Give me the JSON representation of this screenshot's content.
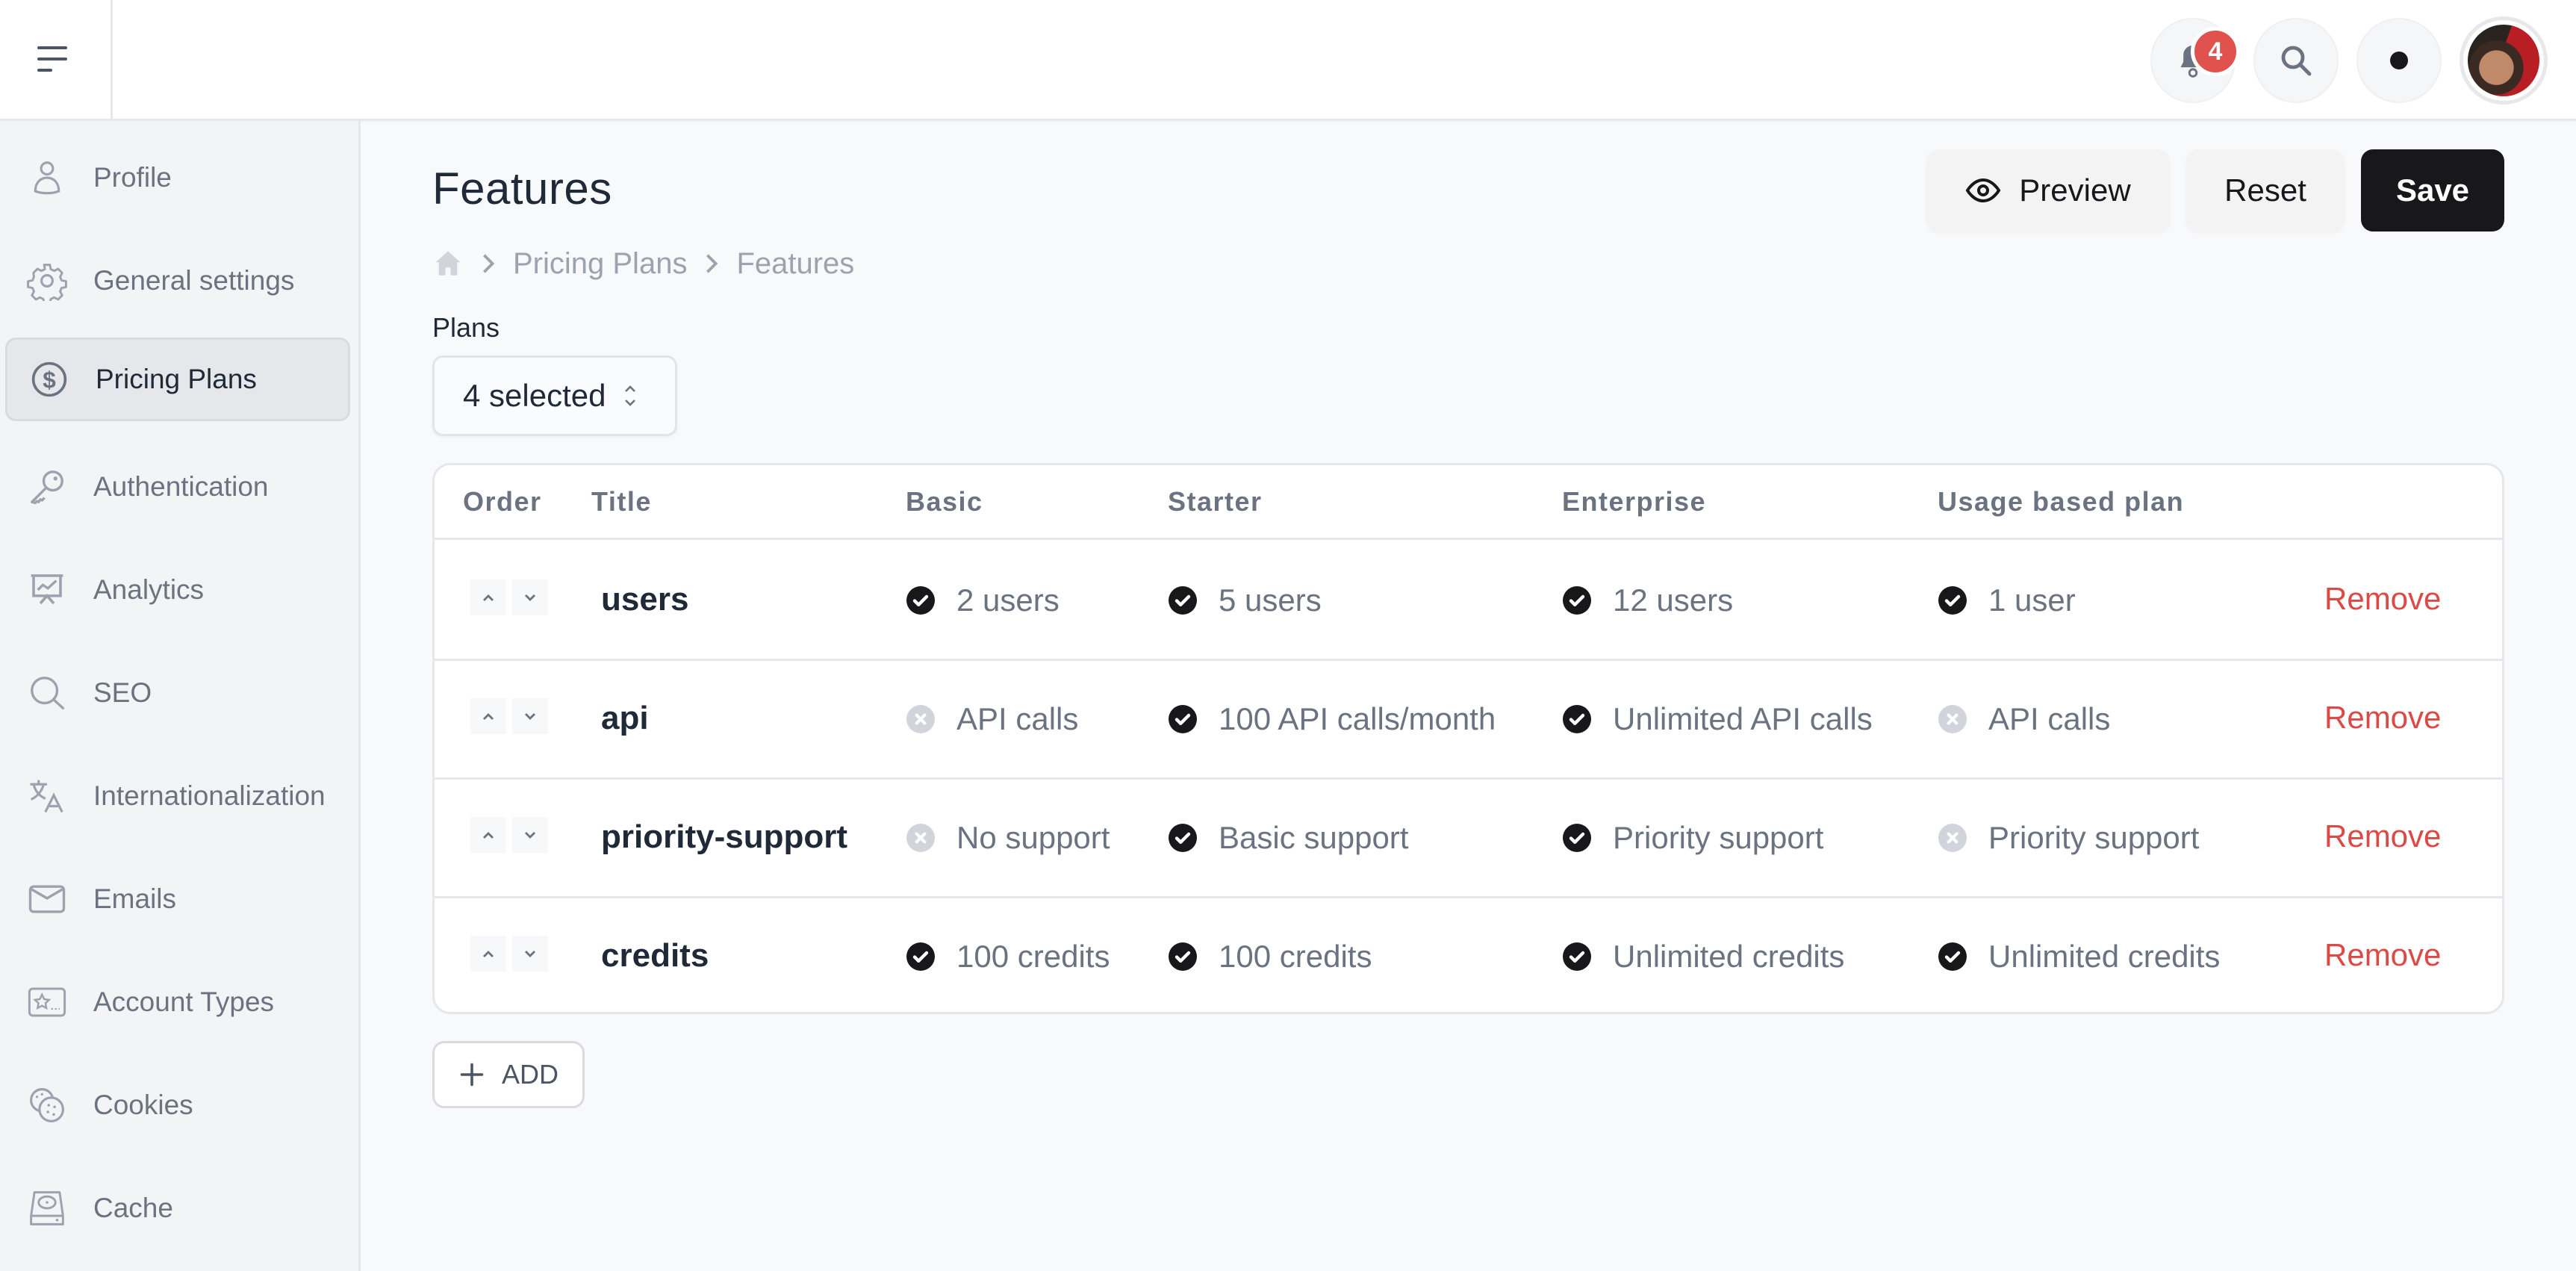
{
  "topbar": {
    "menu_icon": "menu-icon",
    "notifications": {
      "icon": "bell-icon",
      "count": "4",
      "badge_color": "#e0524d"
    },
    "search_icon": "search-icon",
    "theme_icon": "dot-icon",
    "avatar": "user-avatar"
  },
  "sidebar": {
    "items": [
      {
        "label": "Profile",
        "icon": "user-icon",
        "active": false
      },
      {
        "label": "General settings",
        "icon": "gear-icon",
        "active": false
      },
      {
        "label": "Pricing Plans",
        "icon": "dollar-icon",
        "active": true
      },
      {
        "label": "Authentication",
        "icon": "key-icon",
        "active": false
      },
      {
        "label": "Analytics",
        "icon": "presentation-chart-icon",
        "active": false
      },
      {
        "label": "SEO",
        "icon": "search-icon",
        "active": false
      },
      {
        "label": "Internationalization",
        "icon": "translate-icon",
        "active": false
      },
      {
        "label": "Emails",
        "icon": "envelope-icon",
        "active": false
      },
      {
        "label": "Account Types",
        "icon": "star-card-icon",
        "active": false
      },
      {
        "label": "Cookies",
        "icon": "cookie-icon",
        "active": false
      },
      {
        "label": "Cache",
        "icon": "hard-drive-icon",
        "active": false
      }
    ]
  },
  "page": {
    "title": "Features",
    "breadcrumb": {
      "home_icon": "home-icon",
      "items": [
        "Pricing Plans",
        "Features"
      ]
    },
    "actions": {
      "preview": "Preview",
      "reset": "Reset",
      "save": "Save"
    },
    "plans_filter": {
      "label": "Plans",
      "value": "4 selected"
    }
  },
  "table": {
    "headers": [
      "Order",
      "Title",
      "Basic",
      "Starter",
      "Enterprise",
      "Usage based plan"
    ],
    "remove_label": "Remove",
    "rows": [
      {
        "title": "users",
        "cells": [
          {
            "text": "2 users",
            "included": true
          },
          {
            "text": "5 users",
            "included": true
          },
          {
            "text": "12 users",
            "included": true
          },
          {
            "text": "1 user",
            "included": true
          }
        ]
      },
      {
        "title": "api",
        "cells": [
          {
            "text": "API calls",
            "included": false
          },
          {
            "text": "100 API calls/month",
            "included": true
          },
          {
            "text": "Unlimited API calls",
            "included": true
          },
          {
            "text": "API calls",
            "included": false
          }
        ]
      },
      {
        "title": "priority-support",
        "cells": [
          {
            "text": "No support",
            "included": false
          },
          {
            "text": "Basic support",
            "included": true
          },
          {
            "text": "Priority support",
            "included": true
          },
          {
            "text": "Priority support",
            "included": false
          }
        ]
      },
      {
        "title": "credits",
        "cells": [
          {
            "text": "100 credits",
            "included": true
          },
          {
            "text": "100 credits",
            "included": true
          },
          {
            "text": "Unlimited credits",
            "included": true
          },
          {
            "text": "Unlimited credits",
            "included": true
          }
        ]
      }
    ]
  },
  "add_button": {
    "label": "ADD",
    "icon": "plus-icon"
  },
  "colors": {
    "accent_dark": "#18181b",
    "danger": "#dc4a45",
    "included_icon": "#18181b",
    "excluded_icon": "#d1d5db"
  }
}
